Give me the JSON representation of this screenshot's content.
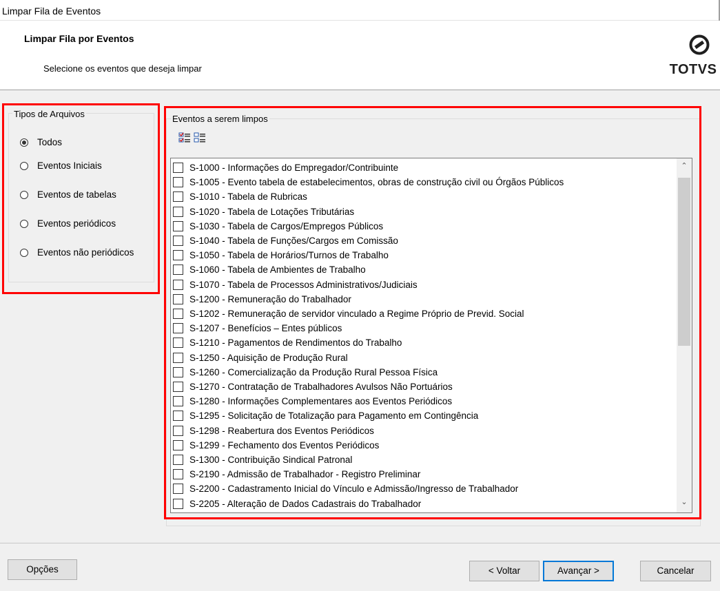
{
  "window": {
    "title": "Limpar Fila de Eventos"
  },
  "header": {
    "title": "Limpar Fila por Eventos",
    "subtitle": "Selecione os eventos que deseja limpar",
    "logo_text": "TOTVS"
  },
  "tipos": {
    "label": "Tipos de Arquivos",
    "selected": "Todos",
    "options": [
      "Todos",
      "Eventos Iniciais",
      "Eventos de tabelas",
      "Eventos periódicos",
      "Eventos não periódicos"
    ]
  },
  "eventos": {
    "label": "Eventos a serem limpos",
    "toolbar_icons": [
      "select-all-icon",
      "deselect-all-icon"
    ],
    "items": [
      "S-1000 - Informações do Empregador/Contribuinte",
      "S-1005 - Evento tabela de estabelecimentos, obras de construção civil ou Órgãos Públicos",
      "S-1010 - Tabela de Rubricas",
      "S-1020 - Tabela de Lotações Tributárias",
      "S-1030 - Tabela de Cargos/Empregos Públicos",
      "S-1040 - Tabela de Funções/Cargos em Comissão",
      "S-1050 - Tabela de Horários/Turnos de Trabalho",
      "S-1060 - Tabela de Ambientes de Trabalho",
      "S-1070 - Tabela de Processos Administrativos/Judiciais",
      "S-1200 - Remuneração do Trabalhador",
      "S-1202 - Remuneração de servidor vinculado a Regime Próprio de Previd. Social",
      "S-1207 -  Benefícios – Entes públicos",
      "S-1210 - Pagamentos de Rendimentos do Trabalho",
      "S-1250 - Aquisição de Produção Rural",
      "S-1260 - Comercialização da Produção Rural Pessoa Física",
      "S-1270 - Contratação de Trabalhadores Avulsos Não Portuários",
      "S-1280 - Informações Complementares aos Eventos Periódicos",
      "S-1295 - Solicitação de Totalização para Pagamento em Contingência",
      "S-1298 - Reabertura dos Eventos Periódicos",
      "S-1299 - Fechamento dos Eventos Periódicos",
      "S-1300 - Contribuição Sindical Patronal",
      "S-2190 - Admissão de Trabalhador - Registro Preliminar",
      "S-2200 - Cadastramento Inicial do Vínculo e Admissão/Ingresso de Trabalhador",
      "S-2205 - Alteração de Dados Cadastrais do Trabalhador"
    ]
  },
  "footer": {
    "options_label": "Opções",
    "back_label": "< Voltar",
    "next_label": "Avançar >",
    "cancel_label": "Cancelar"
  },
  "colors": {
    "highlight": "#ff0000",
    "default_button_border": "#0078d7",
    "background": "#f0f0f0"
  }
}
